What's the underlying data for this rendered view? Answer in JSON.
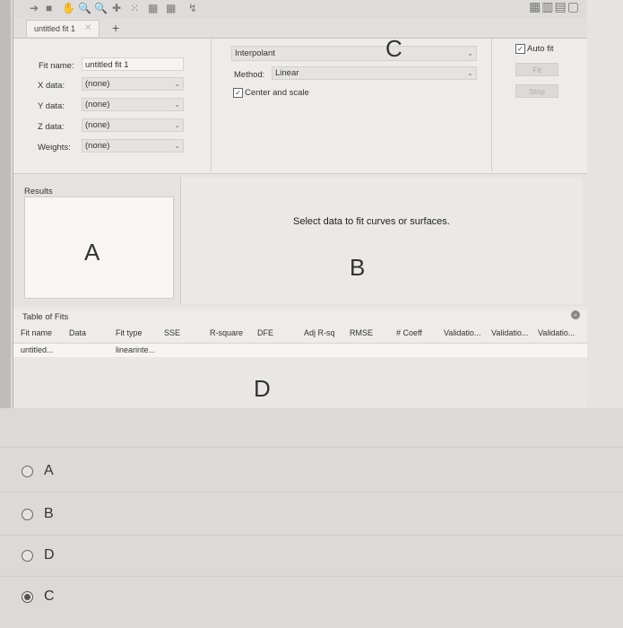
{
  "tab": {
    "label": "untitled fit 1",
    "close": "✕",
    "add": "+"
  },
  "setup": {
    "fit_name_label": "Fit name:",
    "fit_name_value": "untitled fit 1",
    "x_label": "X data:",
    "x_value": "(none)",
    "y_label": "Y data:",
    "y_value": "(none)",
    "z_label": "Z data:",
    "z_value": "(none)",
    "w_label": "Weights:",
    "w_value": "(none)",
    "fit_type": "Interpolant",
    "method_label": "Method:",
    "method_value": "Linear",
    "center_scale_label": "Center and scale",
    "auto_fit_label": "Auto fit",
    "fit_button": "Fit",
    "stop_button": "Stop"
  },
  "results": {
    "title": "Results",
    "message": "Select data to fit curves or surfaces."
  },
  "table_of_fits": {
    "title": "Table of Fits",
    "headers": [
      "Fit name",
      "Data",
      "Fit type",
      "SSE",
      "R-square",
      "DFE",
      "Adj R-sq",
      "RMSE",
      "# Coeff",
      "Validatio...",
      "Validatio...",
      "Validatio..."
    ],
    "row": {
      "fit_name": "untitled...",
      "fit_type": "linearinte..."
    }
  },
  "annotations": {
    "a": "A",
    "b": "B",
    "c": "C",
    "d": "D"
  },
  "options": [
    {
      "label": "A",
      "selected": false
    },
    {
      "label": "B",
      "selected": false
    },
    {
      "label": "D",
      "selected": false
    },
    {
      "label": "C",
      "selected": true
    }
  ]
}
